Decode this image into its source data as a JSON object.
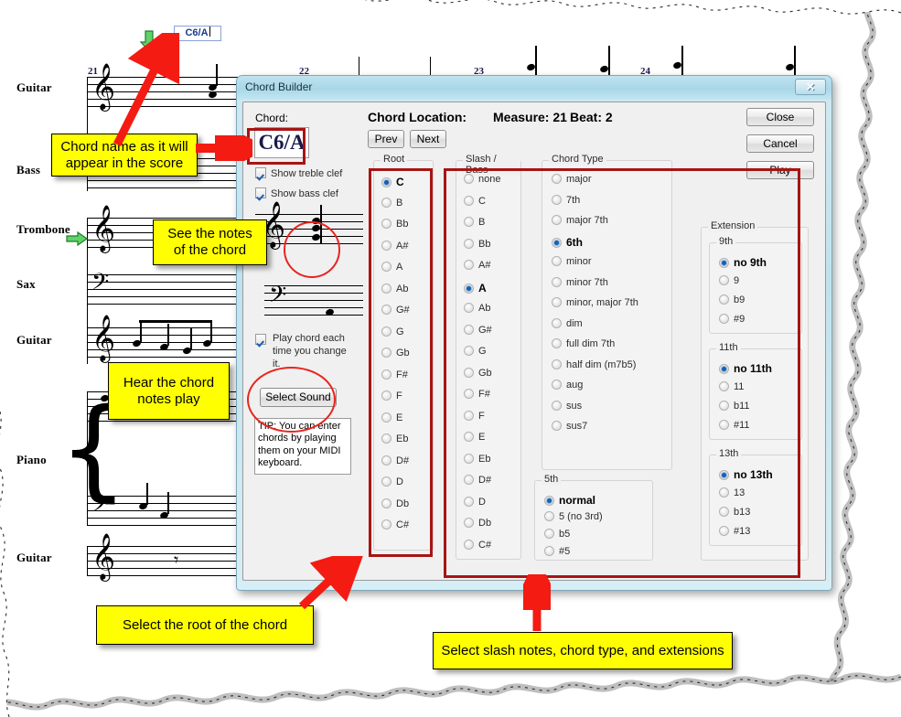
{
  "score": {
    "chord_entry_value": "C6/A",
    "measure_numbers": [
      "21",
      "22",
      "23",
      "24"
    ],
    "staff_labels": [
      "Guitar",
      "Bass",
      "Trombone",
      "Sax",
      "Guitar",
      "Piano",
      "Guitar"
    ]
  },
  "dialog": {
    "title": "Chord Builder",
    "close_icon": "close-x-icon",
    "chord_label": "Chord:",
    "chord_value": "C6/A",
    "checkboxes": [
      {
        "label": "Show treble clef",
        "checked": true
      },
      {
        "label": "Show bass clef",
        "checked": true
      }
    ],
    "location_label": "Chord Location:",
    "location_measure": "Measure: 21",
    "location_beat": "Beat: 2",
    "prev_label": "Prev",
    "next_label": "Next",
    "close_label": "Close",
    "cancel_label": "Cancel",
    "play_label": "Play",
    "play_chord_checkbox": {
      "label": "Play chord each time you change it.",
      "checked": true
    },
    "select_sound_label": "Select Sound",
    "tip_text": "TIP: You can enter chords by playing them on your MIDI keyboard.",
    "root": {
      "caption": "Root",
      "selected": "C",
      "items": [
        "C",
        "B",
        "Bb",
        "A#",
        "A",
        "Ab",
        "G#",
        "G",
        "Gb",
        "F#",
        "F",
        "E",
        "Eb",
        "D#",
        "D",
        "Db",
        "C#"
      ]
    },
    "slash_bass": {
      "caption": "Slash / Bass",
      "selected": "A",
      "items": [
        "none",
        "C",
        "B",
        "Bb",
        "A#",
        "A",
        "Ab",
        "G#",
        "G",
        "Gb",
        "F#",
        "F",
        "E",
        "Eb",
        "D#",
        "D",
        "Db",
        "C#"
      ]
    },
    "chord_type": {
      "caption": "Chord Type",
      "selected": "6th",
      "items": [
        "major",
        "7th",
        "major 7th",
        "6th",
        "minor",
        "minor 7th",
        "minor, major 7th",
        "dim",
        "full dim 7th",
        "half dim (m7b5)",
        "aug",
        "sus",
        "sus7"
      ]
    },
    "fifth": {
      "caption": "5th",
      "selected": "normal",
      "items": [
        "normal",
        "5 (no 3rd)",
        "b5",
        "#5"
      ]
    },
    "extension": {
      "caption": "Extension",
      "groups": [
        {
          "caption": "9th",
          "selected": "no 9th",
          "items": [
            "no 9th",
            "9",
            "b9",
            "#9"
          ]
        },
        {
          "caption": "11th",
          "selected": "no 11th",
          "items": [
            "no 11th",
            "11",
            "b11",
            "#11"
          ]
        },
        {
          "caption": "13th",
          "selected": "no 13th",
          "items": [
            "no 13th",
            "13",
            "b13",
            "#13"
          ]
        }
      ]
    }
  },
  "annotations": [
    {
      "id": "chord-name-callout",
      "text": "Chord name as it will appear in the score"
    },
    {
      "id": "see-notes-callout",
      "text": "See the notes of the chord"
    },
    {
      "id": "hear-chord-callout",
      "text": "Hear the chord notes play"
    },
    {
      "id": "select-root-callout",
      "text": "Select the root of the chord"
    },
    {
      "id": "select-slash-callout",
      "text": "Select slash notes, chord type, and extensions"
    }
  ],
  "colors": {
    "callout_bg": "#ffff00",
    "highlight_red": "#a71414",
    "circle_red": "#e8241f",
    "title_bar": "#bfe2ee",
    "radio_accent": "#1461b5"
  }
}
